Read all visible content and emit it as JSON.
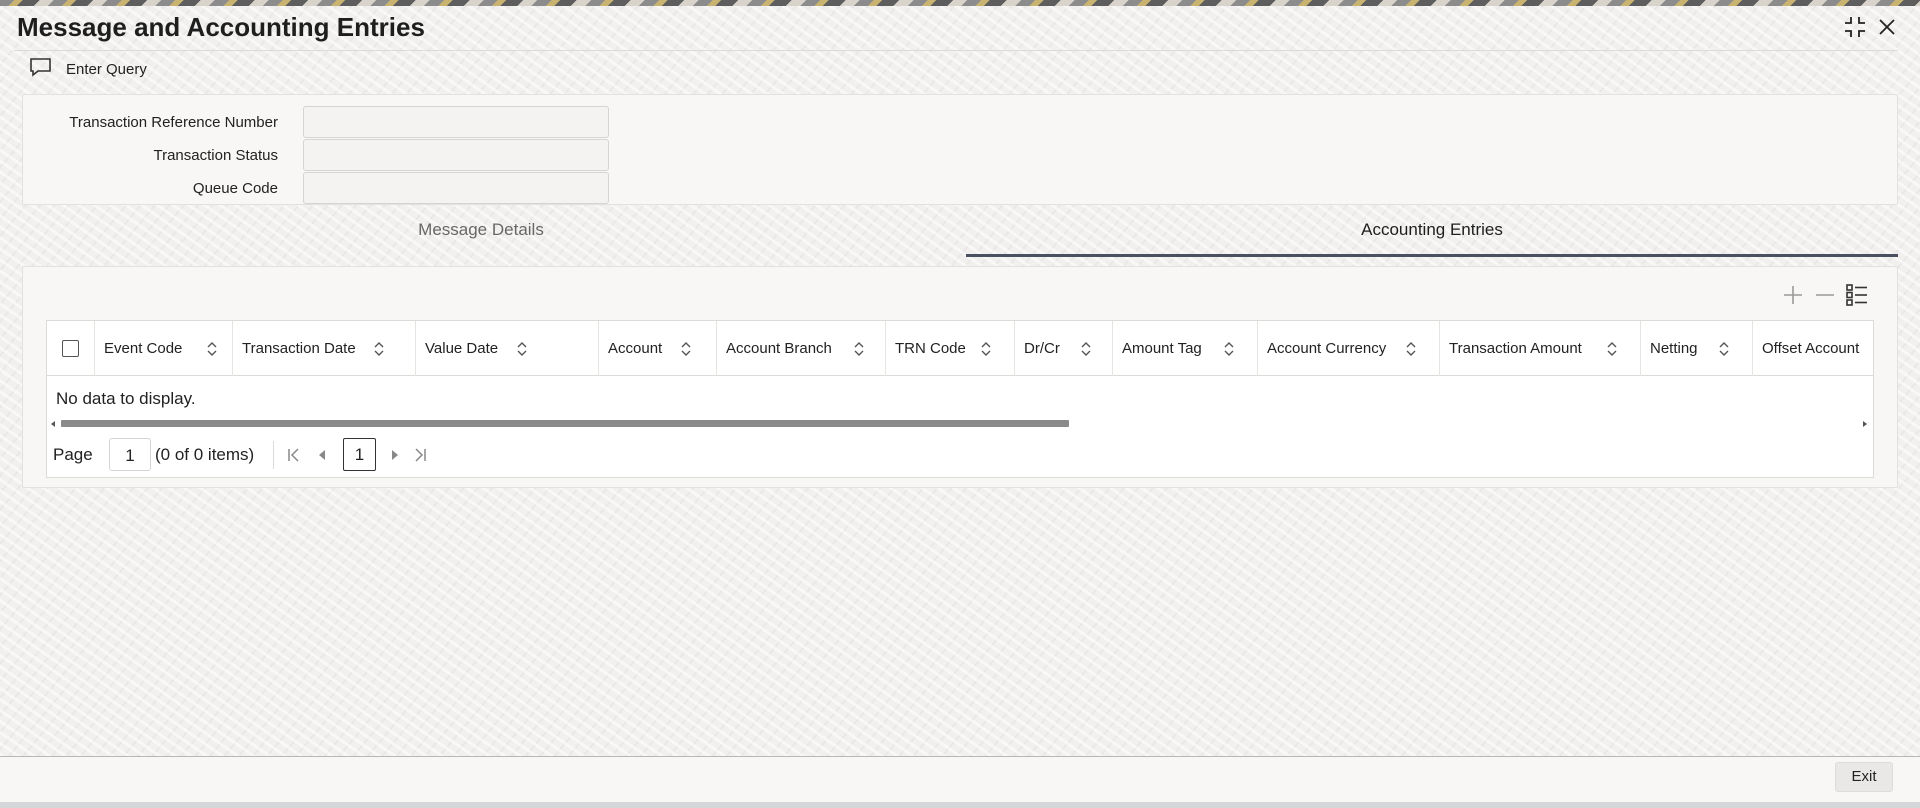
{
  "window": {
    "title": "Message and Accounting Entries",
    "controls": [
      "maximize-icon",
      "close-icon"
    ]
  },
  "toolbar": {
    "enter_query_label": "Enter Query",
    "enter_query_icon": "chat-bubble-icon"
  },
  "form": {
    "fields": [
      {
        "label": "Transaction Reference Number",
        "value": ""
      },
      {
        "label": "Transaction Status",
        "value": ""
      },
      {
        "label": "Queue Code",
        "value": ""
      }
    ]
  },
  "tabs": [
    {
      "label": "Message Details",
      "active": false
    },
    {
      "label": "Accounting Entries",
      "active": true
    }
  ],
  "grid": {
    "tools": [
      "add-row-icon",
      "delete-row-icon",
      "column-settings-icon"
    ],
    "columns": [
      "Event Code",
      "Transaction Date",
      "Value Date",
      "Account",
      "Account Branch",
      "TRN Code",
      "Dr/Cr",
      "Amount Tag",
      "Account Currency",
      "Transaction Amount",
      "Netting",
      "Offset Account"
    ],
    "rows": [],
    "empty_message": "No data to display.",
    "pagination": {
      "page_label": "Page",
      "page_input": "1",
      "count_text": "(0 of 0 items)",
      "current_page": "1"
    }
  },
  "footer": {
    "exit_label": "Exit"
  },
  "colors": {
    "accent_tab_underline": "#4a5060",
    "background": "#f3f2f0"
  }
}
